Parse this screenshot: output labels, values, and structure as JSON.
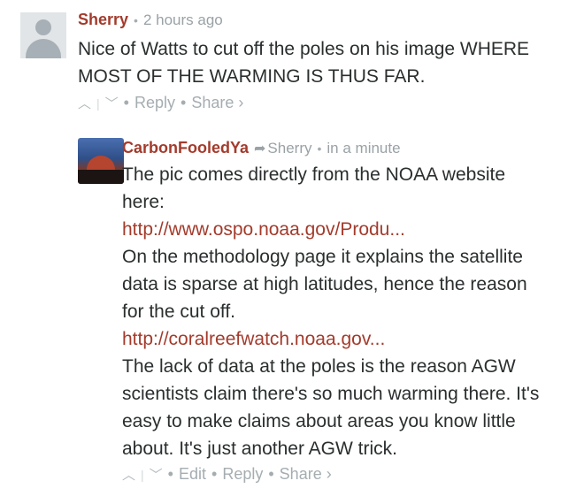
{
  "comments": [
    {
      "author": "Sherry",
      "time": "2 hours ago",
      "text_lines": [
        "Nice of Watts to cut off the poles on his image WHERE",
        "MOST OF THE WARMING IS THUS FAR."
      ],
      "actions": {
        "reply": "Reply",
        "share": "Share ›"
      }
    },
    {
      "author": "CarbonFooledYa",
      "reply_to": "Sherry",
      "time": "in a minute",
      "paragraphs": [
        "The pic comes directly from the NOAA website",
        "here:"
      ],
      "link1": "http://www.ospo.noaa.gov/Produ...",
      "para2_lines": [
        "On the methodology page it explains the satellite",
        "data is sparse at high latitudes, hence the reason",
        "for the cut off."
      ],
      "link2": "http://coralreefwatch.noaa.gov...",
      "para3_lines": [
        "The lack of data at the poles is the reason AGW",
        "scientists claim there's so much warming there. It's",
        "easy to make claims about areas you know little",
        "about. It's just another AGW trick."
      ],
      "actions": {
        "edit": "Edit",
        "reply": "Reply",
        "share": "Share ›"
      }
    }
  ],
  "icons": {
    "upvote": "up-chevron",
    "downvote": "down-chevron",
    "reply_arrow": "reply-arrow"
  }
}
